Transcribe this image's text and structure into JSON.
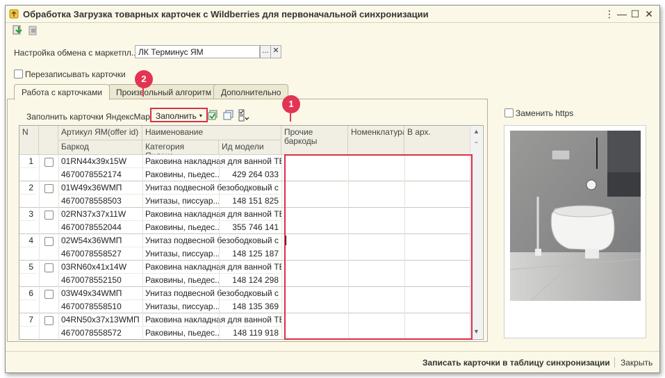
{
  "window": {
    "title": "Обработка  Загрузка товарных карточек с Wildberries для первоначальной синхронизации",
    "minimize": "—",
    "maximize": "☐",
    "close": "✕"
  },
  "form": {
    "exchange_label": "Настройка обмена с маркетпл...",
    "exchange_value": "ЛК Терминус ЯМ",
    "exchange_select": "...",
    "exchange_clear": "✕",
    "overwrite_label": "Перезаписывать карточки",
    "replace_https_label": "Заменить https"
  },
  "tabs": [
    {
      "label": "Работа с карточками"
    },
    {
      "label": "Произвольный алгоритм"
    },
    {
      "label": "Дополнительно"
    }
  ],
  "inner": {
    "fill_label": "Заполнить карточки ЯндексМаркет",
    "fill_button": "Заполнить",
    "fill_caret": "▾"
  },
  "grid": {
    "headers": {
      "n": "N",
      "article": "Артикул ЯМ(offer id)",
      "barcode": "Баркод",
      "name": "Наименование",
      "category": "Категория Яндекс...",
      "model_id": "Ид модели",
      "other_barcodes": "Прочие баркоды",
      "nomenclature": "Номенклатура",
      "archive": "В арх."
    },
    "rows": [
      {
        "n": "1",
        "article": "01RN44x39x15W",
        "barcode": "4670078552174",
        "name": "Раковина накладная для ванной ТЕ...",
        "category": "Раковины, пьедес...",
        "model_id": "429 264 033"
      },
      {
        "n": "2",
        "article": "01W49x36WМП",
        "barcode": "4670078558503",
        "name": "Унитаз подвесной безободковый с ...",
        "category": "Унитазы, писсуар...",
        "model_id": "148 151 825"
      },
      {
        "n": "3",
        "article": "02RN37x37x11W",
        "barcode": "4670078552044",
        "name": "Раковина накладная для ванной ТЕ...",
        "category": "Раковины, пьедес...",
        "model_id": "355 746 141"
      },
      {
        "n": "4",
        "article": "02W54x36WМП",
        "barcode": "4670078558527",
        "name": "Унитаз подвесной безободковый с ...",
        "category": "Унитазы, писсуар...",
        "model_id": "148 125 187"
      },
      {
        "n": "5",
        "article": "03RN60x41x14W",
        "barcode": "4670078552150",
        "name": "Раковина накладная для ванной ТЕ...",
        "category": "Раковины, пьедес...",
        "model_id": "148 124 298"
      },
      {
        "n": "6",
        "article": "03W49x34WМП",
        "barcode": "4670078558510",
        "name": "Унитаз подвесной безободковый с ...",
        "category": "Унитазы, писсуар...",
        "model_id": "148 135 369"
      },
      {
        "n": "7",
        "article": "04RN50x37x13WМП",
        "barcode": "4670078558572",
        "name": "Раковина накладная для ванной ТЕ...",
        "category": "Раковины, пьедес...",
        "model_id": "148 119 918"
      }
    ]
  },
  "callouts": {
    "one": "1",
    "two": "2"
  },
  "footer": {
    "primary": "Записать карточки в таблицу синхронизации",
    "close": "Закрыть"
  },
  "colors": {
    "accent": "#d7304a",
    "background": "#fbf8e7"
  }
}
